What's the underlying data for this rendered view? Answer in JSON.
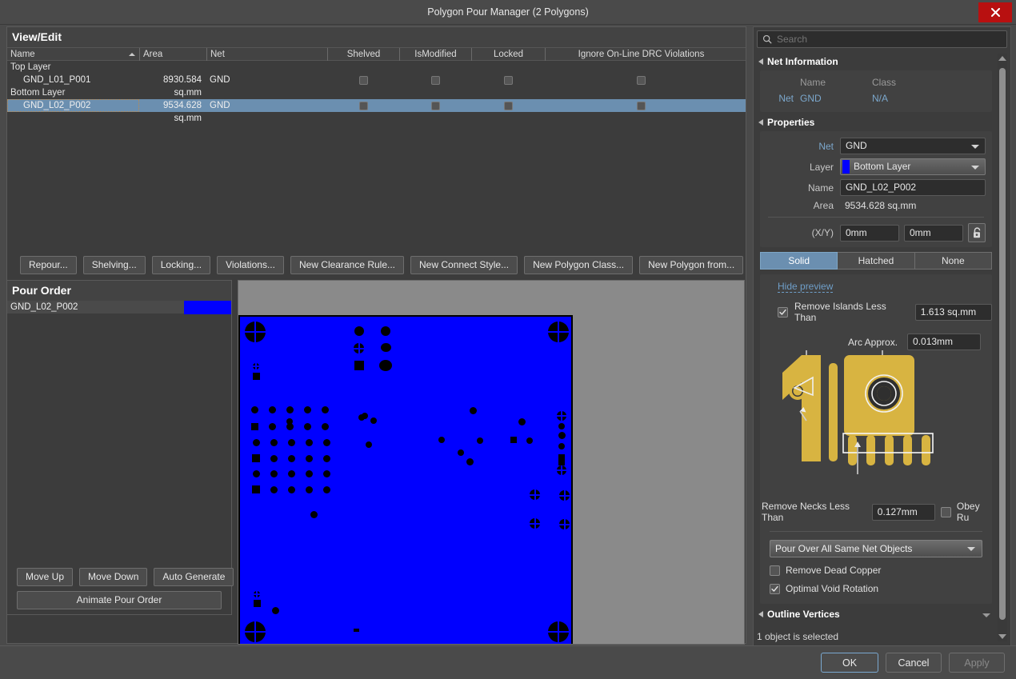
{
  "window": {
    "title": "Polygon Pour Manager (2 Polygons)",
    "close_label": "✕"
  },
  "view_edit": {
    "title": "View/Edit",
    "columns": [
      "Name",
      "Area",
      "Net",
      "Shelved",
      "IsModified",
      "Locked",
      "Ignore On-Line DRC Violations"
    ],
    "groups": [
      {
        "label": "Top Layer",
        "rows": [
          {
            "name": "GND_L01_P001",
            "area": "8930.584 sq.mm",
            "net": "GND",
            "shelved": false,
            "is_modified": false,
            "locked": false,
            "ignore_drc": false,
            "selected": false
          }
        ]
      },
      {
        "label": "Bottom Layer",
        "rows": [
          {
            "name": "GND_L02_P002",
            "area": "9534.628 sq.mm",
            "net": "GND",
            "shelved": false,
            "is_modified": false,
            "locked": false,
            "ignore_drc": false,
            "selected": true
          }
        ]
      }
    ],
    "actions": [
      "Repour...",
      "Shelving...",
      "Locking...",
      "Violations...",
      "New Clearance Rule...",
      "New Connect Style...",
      "New Polygon Class...",
      "New Polygon from..."
    ]
  },
  "pour_order": {
    "title": "Pour Order",
    "items": [
      {
        "name": "GND_L02_P002",
        "color": "#0000ff"
      }
    ],
    "buttons": {
      "move_up": "Move Up",
      "move_down": "Move Down",
      "auto_generate": "Auto Generate",
      "animate": "Animate Pour Order"
    }
  },
  "preview_canvas": {
    "board_color": "#0000ff",
    "background_color": "#8a8a8a"
  },
  "sidebar": {
    "search_placeholder": "Search",
    "net_information": {
      "title": "Net Information",
      "col_name": "Name",
      "col_class": "Class",
      "row_label": "Net",
      "net_name": "GND",
      "net_class": "N/A"
    },
    "properties": {
      "title": "Properties",
      "net_label": "Net",
      "net_value": "GND",
      "layer_label": "Layer",
      "layer_value": "Bottom Layer",
      "layer_color": "#0000ff",
      "name_label": "Name",
      "name_value": "GND_L02_P002",
      "area_label": "Area",
      "area_value": "9534.628 sq.mm",
      "xy_label": "(X/Y)",
      "x_value": "0mm",
      "y_value": "0mm",
      "lock_icon": "unlock-icon"
    },
    "fill_modes": {
      "options": [
        "Solid",
        "Hatched",
        "None"
      ],
      "selected": "Solid"
    },
    "preview": {
      "toggle_label": "Hide preview",
      "remove_islands_label": "Remove Islands Less Than",
      "remove_islands_checked": true,
      "remove_islands_value": "1.613 sq.mm",
      "arc_approx_label": "Arc Approx.",
      "arc_approx_value": "0.013mm",
      "remove_necks_label": "Remove Necks Less Than",
      "remove_necks_value": "0.127mm",
      "obey_rules_label": "Obey Ru",
      "obey_rules_checked": false,
      "copper_color": "#d8b441"
    },
    "pour_over": {
      "selected": "Pour Over All Same Net Objects",
      "remove_dead_copper_label": "Remove Dead Copper",
      "remove_dead_copper_checked": false,
      "optimal_void_rotation_label": "Optimal Void Rotation",
      "optimal_void_rotation_checked": true
    },
    "outline_vertices": {
      "title": "Outline Vertices"
    },
    "status": "1 object is selected"
  },
  "footer": {
    "ok": "OK",
    "cancel": "Cancel",
    "apply": "Apply"
  },
  "colors": {
    "selection_blue": "#6b8fb0",
    "accent_blue": "#7ba7cc",
    "close_red": "#b81010",
    "copper": "#d8b441",
    "board_blue": "#0000ff"
  }
}
